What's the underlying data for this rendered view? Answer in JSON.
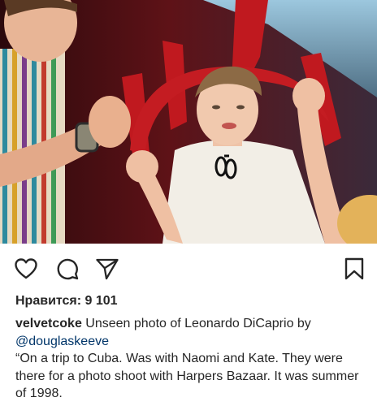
{
  "post": {
    "photo_alt": "",
    "likes_label": "Нравится: 9 101",
    "caption": {
      "username": "velvetcoke",
      "text_first": " Unseen photo of Leonardo DiCaprio by",
      "mention": "@douglaskeeve",
      "quote": "“On a trip to Cuba.  Was with Naomi and Kate.  They were there for a photo shoot with Harpers Bazaar.  It was summer of 1998."
    }
  },
  "icons": {
    "like": "heart-icon",
    "comment": "comment-bubble-icon",
    "share": "paper-plane-icon",
    "save": "bookmark-icon"
  },
  "colors": {
    "text": "#262626",
    "mention": "#003569",
    "photo_red": "#b0181d",
    "photo_dark": "#3a0d10"
  }
}
